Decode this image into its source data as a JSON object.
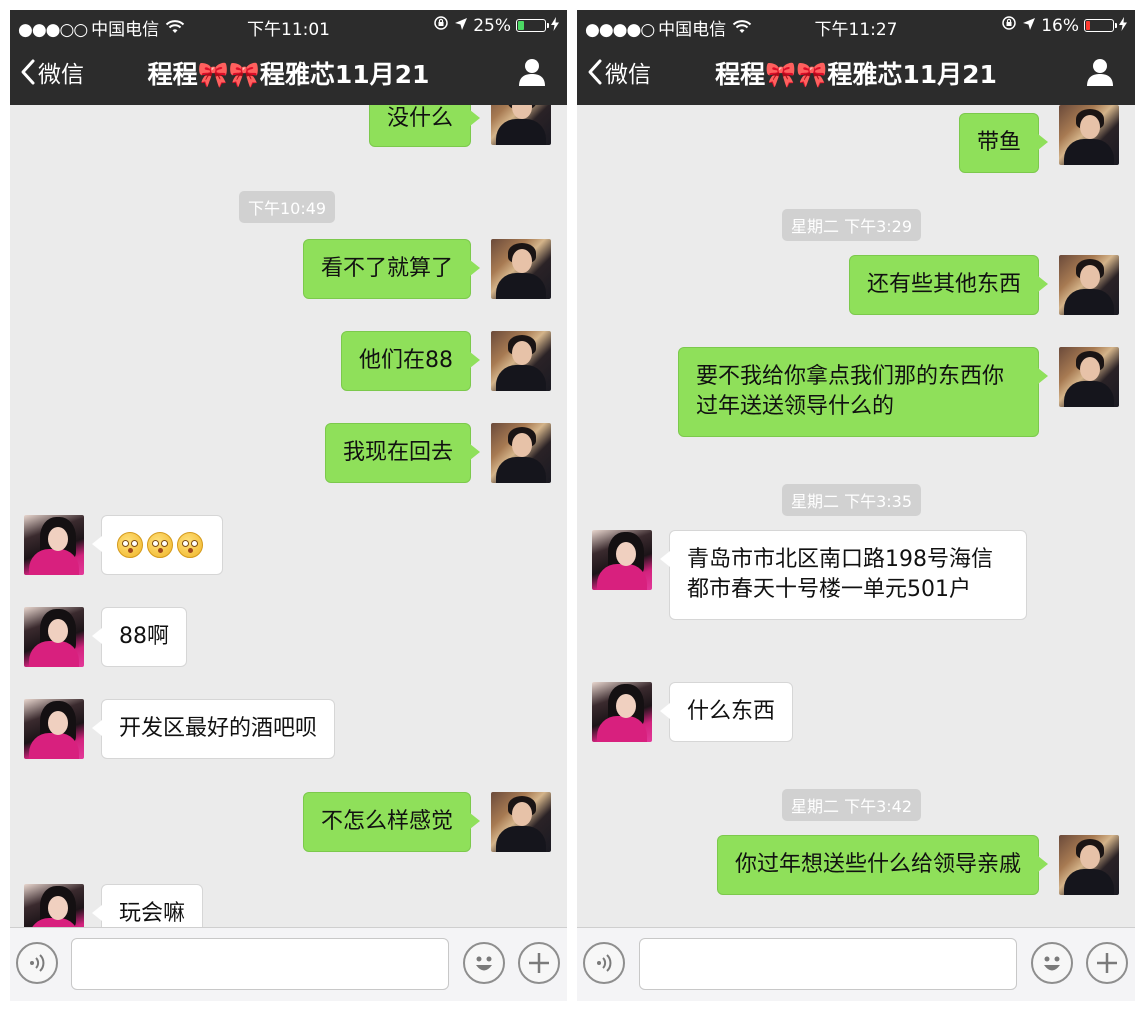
{
  "screens": [
    {
      "status": {
        "signal": "●●●○○",
        "carrier": "中国电信",
        "time": "下午11:01",
        "battery": "25%",
        "battery_level": 0.25
      },
      "nav": {
        "back_label": "微信",
        "title": "程程🎀🎀程雅芯11月21"
      },
      "messages": {
        "m0": "没什么",
        "t1": "下午10:49",
        "m1": "看不了就算了",
        "m2": "他们在88",
        "m3": "我现在回去",
        "m5": "88啊",
        "m6": "开发区最好的酒吧呗",
        "m7": "不怎么样感觉",
        "m8": "玩会嘛"
      },
      "emoji_icon": "flushed-face-icon"
    },
    {
      "status": {
        "signal": "●●●●○",
        "carrier": "中国电信",
        "time": "下午11:27",
        "battery": "16%",
        "battery_level": 0.16
      },
      "nav": {
        "back_label": "微信",
        "title": "程程🎀🎀程雅芯11月21"
      },
      "messages": {
        "m0": "带鱼",
        "t1": "星期二 下午3:29",
        "m1": "还有些其他东西",
        "m2": "要不我给你拿点我们那的东西你过年送送领导什么的",
        "t2": "星期二 下午3:35",
        "m3": "青岛市市北区南口路198号海信都市春天十号楼一单元501户",
        "m4": "什么东西",
        "t3": "星期二 下午3:42",
        "m5": "你过年想送些什么给领导亲戚"
      }
    }
  ],
  "colors": {
    "bar": "#2c2c2c",
    "chat_bg": "#ebebeb",
    "bubble_out": "#8fe05a",
    "bubble_in": "#ffffff",
    "battery_green": "#4cd964",
    "battery_red": "#ff3b30"
  }
}
